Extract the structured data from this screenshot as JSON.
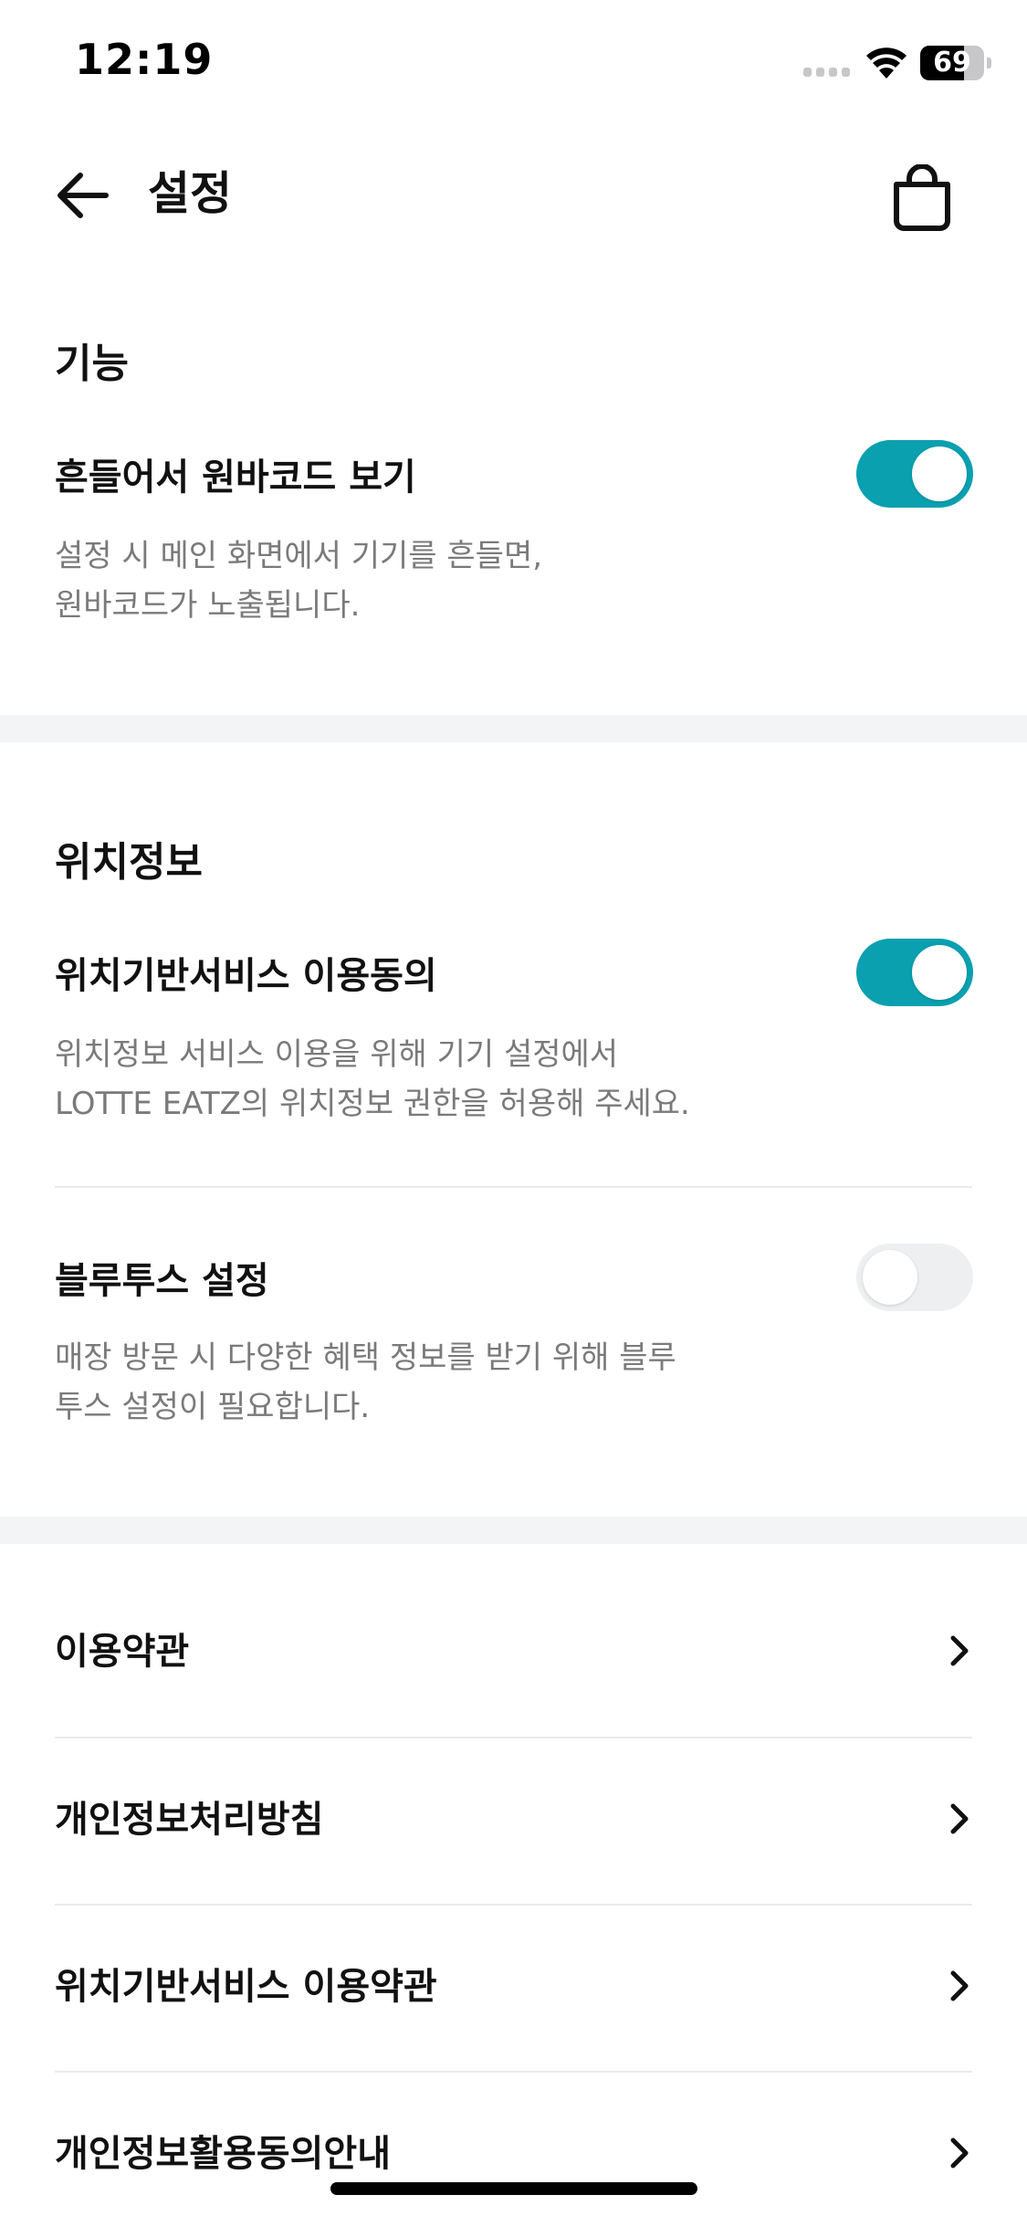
{
  "status_bar": {
    "time": "12:19",
    "battery_text": "69",
    "battery_level": 0.69
  },
  "header": {
    "title": "설정",
    "back_icon": "arrow-left-icon",
    "cart_icon": "shopping-bag-icon"
  },
  "sections": {
    "feature": {
      "title": "기능",
      "shake_barcode": {
        "label": "흔들어서 원바코드 보기",
        "description": "설정 시 메인 화면에서 기기를 흔들면,\n원바코드가 노출됩니다.",
        "enabled": true
      }
    },
    "location": {
      "title": "위치정보",
      "lbs_consent": {
        "label": "위치기반서비스 이용동의",
        "description": "위치정보 서비스 이용을 위해 기기 설정에서\nLOTTE EATZ의 위치정보 권한을 허용해 주세요.",
        "enabled": true
      },
      "bluetooth": {
        "label": "블루투스 설정",
        "description": "매장 방문 시 다양한 혜택 정보를 받기 위해 블루\n투스 설정이 필요합니다.",
        "enabled": false
      }
    }
  },
  "links": [
    {
      "label": "이용약관"
    },
    {
      "label": "개인정보처리방침"
    },
    {
      "label": "위치기반서비스 이용약관"
    },
    {
      "label": "개인정보활용동의안내"
    }
  ],
  "colors": {
    "toggle_on": "#0aa0b0",
    "toggle_off": "#eeeff1",
    "section_band": "#f3f4f6",
    "description_text": "#7a7a7a"
  }
}
